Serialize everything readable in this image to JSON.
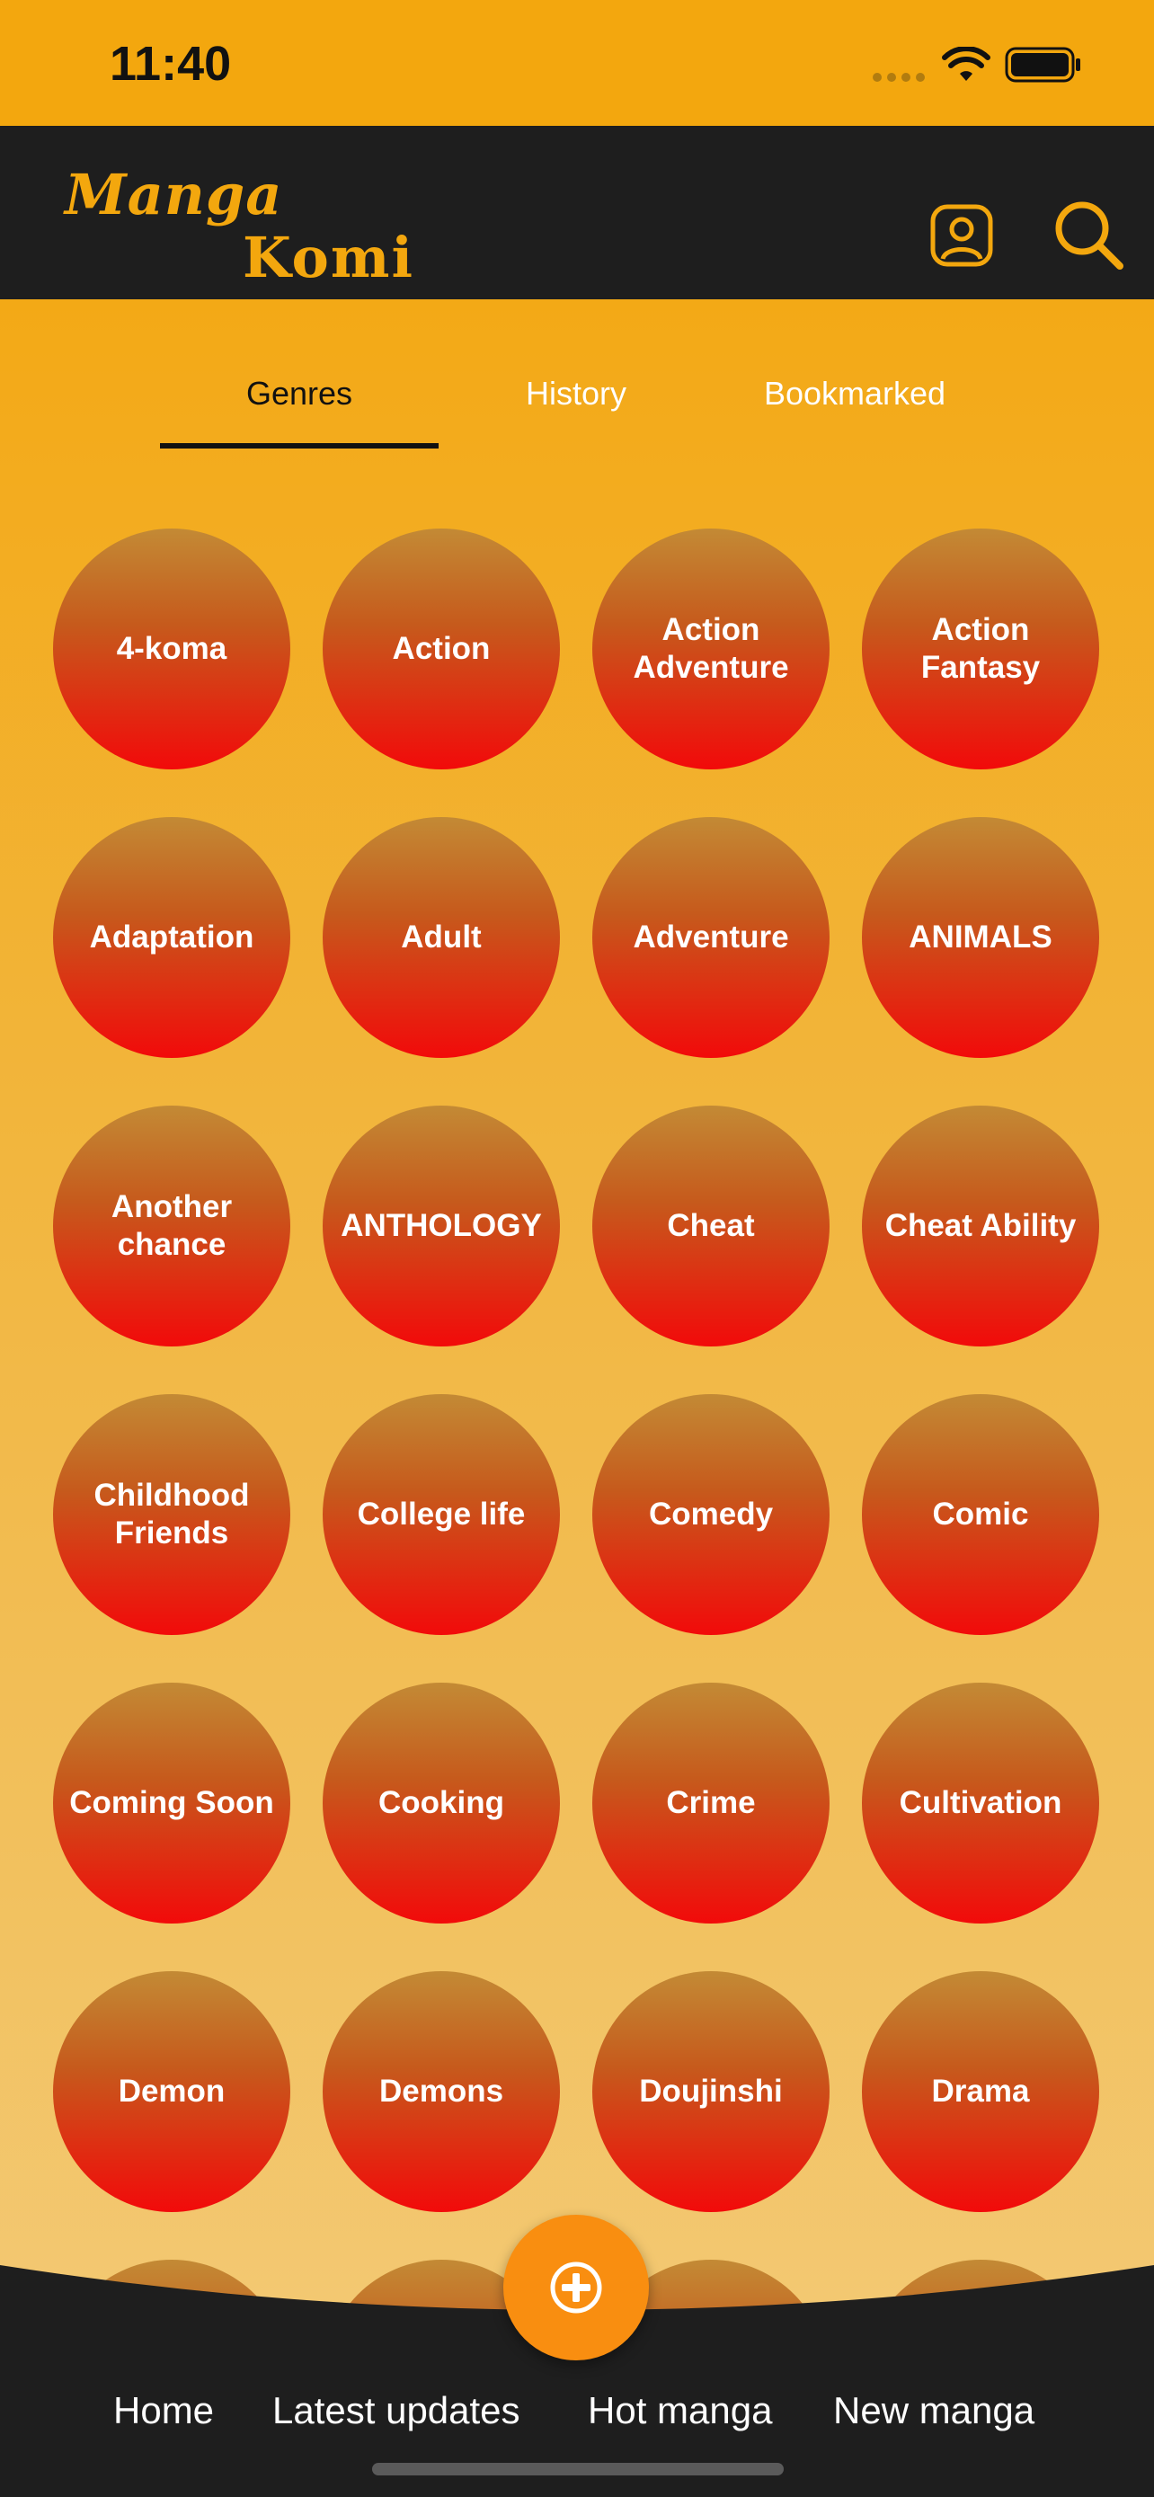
{
  "status_bar": {
    "time": "11:40"
  },
  "header": {
    "logo_line1": "Manga",
    "logo_line2": "Komi"
  },
  "tabs": [
    {
      "label": "Genres",
      "active": true
    },
    {
      "label": "History",
      "active": false
    },
    {
      "label": "Bookmarked",
      "active": false
    }
  ],
  "genres": [
    "4-koma",
    "Action",
    "Action Adventure",
    "Action Fantasy",
    "Adaptation",
    "Adult",
    "Adventure",
    "ANIMALS",
    "Another chance",
    "ANTHOLOGY",
    "Cheat",
    "Cheat Ability",
    "Childhood Friends",
    "College life",
    "Comedy",
    "Comic",
    "Coming Soon",
    "Cooking",
    "Crime",
    "Cultivation",
    "Demon",
    "Demons",
    "Doujinshi",
    "Drama"
  ],
  "bottom_nav": [
    {
      "label": "Home"
    },
    {
      "label": "Latest updates"
    },
    {
      "label": "Hot manga"
    },
    {
      "label": "New manga"
    }
  ],
  "fab_icon": "plus-circle-icon",
  "colors": {
    "accent": "#f3a70e",
    "header_bg": "#1e1e1e",
    "genre_top": "#c38a35",
    "genre_bottom": "#f20a0a",
    "fab": "#f98e10"
  }
}
